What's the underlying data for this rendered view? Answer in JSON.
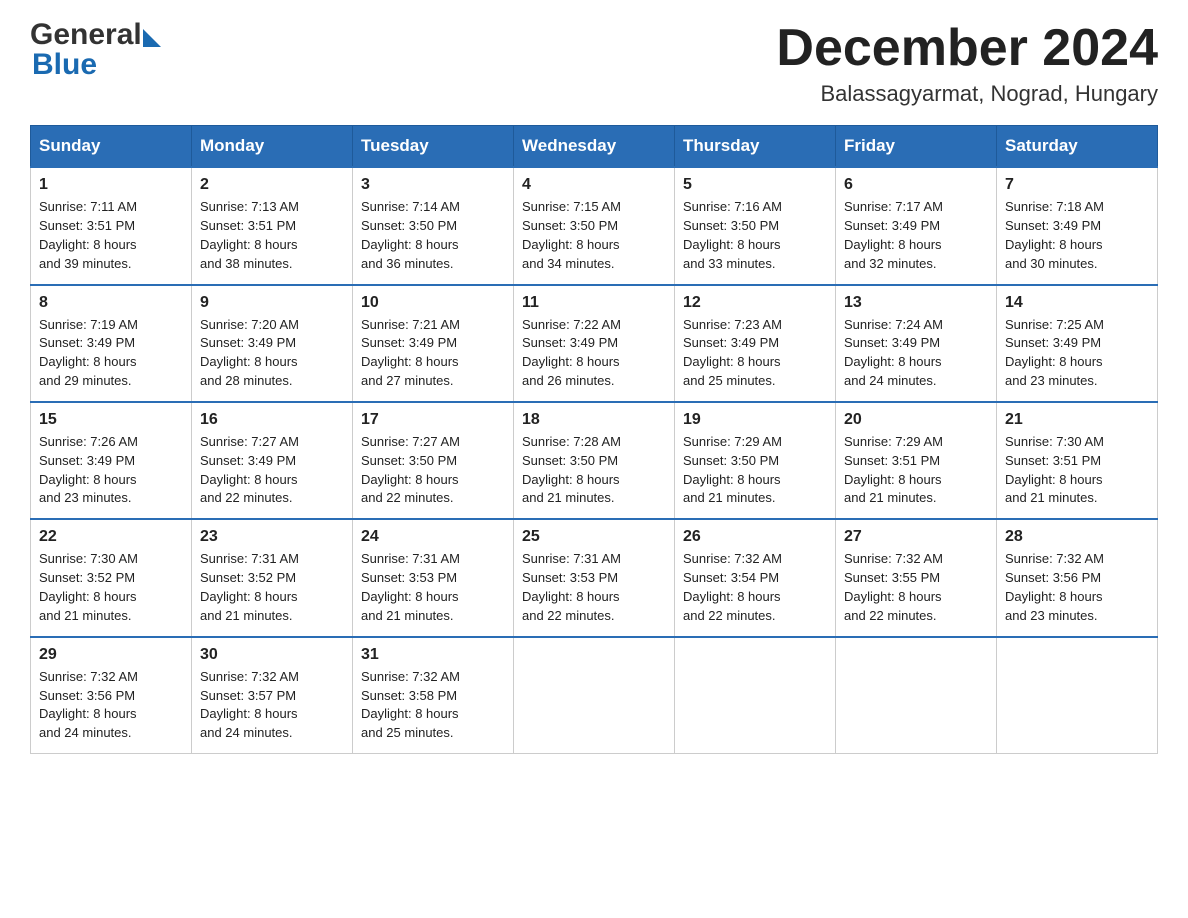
{
  "header": {
    "month_title": "December 2024",
    "location": "Balassagyarmat, Nograd, Hungary",
    "logo_general": "General",
    "logo_blue": "Blue"
  },
  "weekdays": [
    "Sunday",
    "Monday",
    "Tuesday",
    "Wednesday",
    "Thursday",
    "Friday",
    "Saturday"
  ],
  "weeks": [
    [
      {
        "day": 1,
        "sunrise": "7:11 AM",
        "sunset": "3:51 PM",
        "daylight": "8 hours and 39 minutes."
      },
      {
        "day": 2,
        "sunrise": "7:13 AM",
        "sunset": "3:51 PM",
        "daylight": "8 hours and 38 minutes."
      },
      {
        "day": 3,
        "sunrise": "7:14 AM",
        "sunset": "3:50 PM",
        "daylight": "8 hours and 36 minutes."
      },
      {
        "day": 4,
        "sunrise": "7:15 AM",
        "sunset": "3:50 PM",
        "daylight": "8 hours and 34 minutes."
      },
      {
        "day": 5,
        "sunrise": "7:16 AM",
        "sunset": "3:50 PM",
        "daylight": "8 hours and 33 minutes."
      },
      {
        "day": 6,
        "sunrise": "7:17 AM",
        "sunset": "3:49 PM",
        "daylight": "8 hours and 32 minutes."
      },
      {
        "day": 7,
        "sunrise": "7:18 AM",
        "sunset": "3:49 PM",
        "daylight": "8 hours and 30 minutes."
      }
    ],
    [
      {
        "day": 8,
        "sunrise": "7:19 AM",
        "sunset": "3:49 PM",
        "daylight": "8 hours and 29 minutes."
      },
      {
        "day": 9,
        "sunrise": "7:20 AM",
        "sunset": "3:49 PM",
        "daylight": "8 hours and 28 minutes."
      },
      {
        "day": 10,
        "sunrise": "7:21 AM",
        "sunset": "3:49 PM",
        "daylight": "8 hours and 27 minutes."
      },
      {
        "day": 11,
        "sunrise": "7:22 AM",
        "sunset": "3:49 PM",
        "daylight": "8 hours and 26 minutes."
      },
      {
        "day": 12,
        "sunrise": "7:23 AM",
        "sunset": "3:49 PM",
        "daylight": "8 hours and 25 minutes."
      },
      {
        "day": 13,
        "sunrise": "7:24 AM",
        "sunset": "3:49 PM",
        "daylight": "8 hours and 24 minutes."
      },
      {
        "day": 14,
        "sunrise": "7:25 AM",
        "sunset": "3:49 PM",
        "daylight": "8 hours and 23 minutes."
      }
    ],
    [
      {
        "day": 15,
        "sunrise": "7:26 AM",
        "sunset": "3:49 PM",
        "daylight": "8 hours and 23 minutes."
      },
      {
        "day": 16,
        "sunrise": "7:27 AM",
        "sunset": "3:49 PM",
        "daylight": "8 hours and 22 minutes."
      },
      {
        "day": 17,
        "sunrise": "7:27 AM",
        "sunset": "3:50 PM",
        "daylight": "8 hours and 22 minutes."
      },
      {
        "day": 18,
        "sunrise": "7:28 AM",
        "sunset": "3:50 PM",
        "daylight": "8 hours and 21 minutes."
      },
      {
        "day": 19,
        "sunrise": "7:29 AM",
        "sunset": "3:50 PM",
        "daylight": "8 hours and 21 minutes."
      },
      {
        "day": 20,
        "sunrise": "7:29 AM",
        "sunset": "3:51 PM",
        "daylight": "8 hours and 21 minutes."
      },
      {
        "day": 21,
        "sunrise": "7:30 AM",
        "sunset": "3:51 PM",
        "daylight": "8 hours and 21 minutes."
      }
    ],
    [
      {
        "day": 22,
        "sunrise": "7:30 AM",
        "sunset": "3:52 PM",
        "daylight": "8 hours and 21 minutes."
      },
      {
        "day": 23,
        "sunrise": "7:31 AM",
        "sunset": "3:52 PM",
        "daylight": "8 hours and 21 minutes."
      },
      {
        "day": 24,
        "sunrise": "7:31 AM",
        "sunset": "3:53 PM",
        "daylight": "8 hours and 21 minutes."
      },
      {
        "day": 25,
        "sunrise": "7:31 AM",
        "sunset": "3:53 PM",
        "daylight": "8 hours and 22 minutes."
      },
      {
        "day": 26,
        "sunrise": "7:32 AM",
        "sunset": "3:54 PM",
        "daylight": "8 hours and 22 minutes."
      },
      {
        "day": 27,
        "sunrise": "7:32 AM",
        "sunset": "3:55 PM",
        "daylight": "8 hours and 22 minutes."
      },
      {
        "day": 28,
        "sunrise": "7:32 AM",
        "sunset": "3:56 PM",
        "daylight": "8 hours and 23 minutes."
      }
    ],
    [
      {
        "day": 29,
        "sunrise": "7:32 AM",
        "sunset": "3:56 PM",
        "daylight": "8 hours and 24 minutes."
      },
      {
        "day": 30,
        "sunrise": "7:32 AM",
        "sunset": "3:57 PM",
        "daylight": "8 hours and 24 minutes."
      },
      {
        "day": 31,
        "sunrise": "7:32 AM",
        "sunset": "3:58 PM",
        "daylight": "8 hours and 25 minutes."
      },
      null,
      null,
      null,
      null
    ]
  ],
  "labels": {
    "sunrise": "Sunrise:",
    "sunset": "Sunset:",
    "daylight": "Daylight:"
  }
}
